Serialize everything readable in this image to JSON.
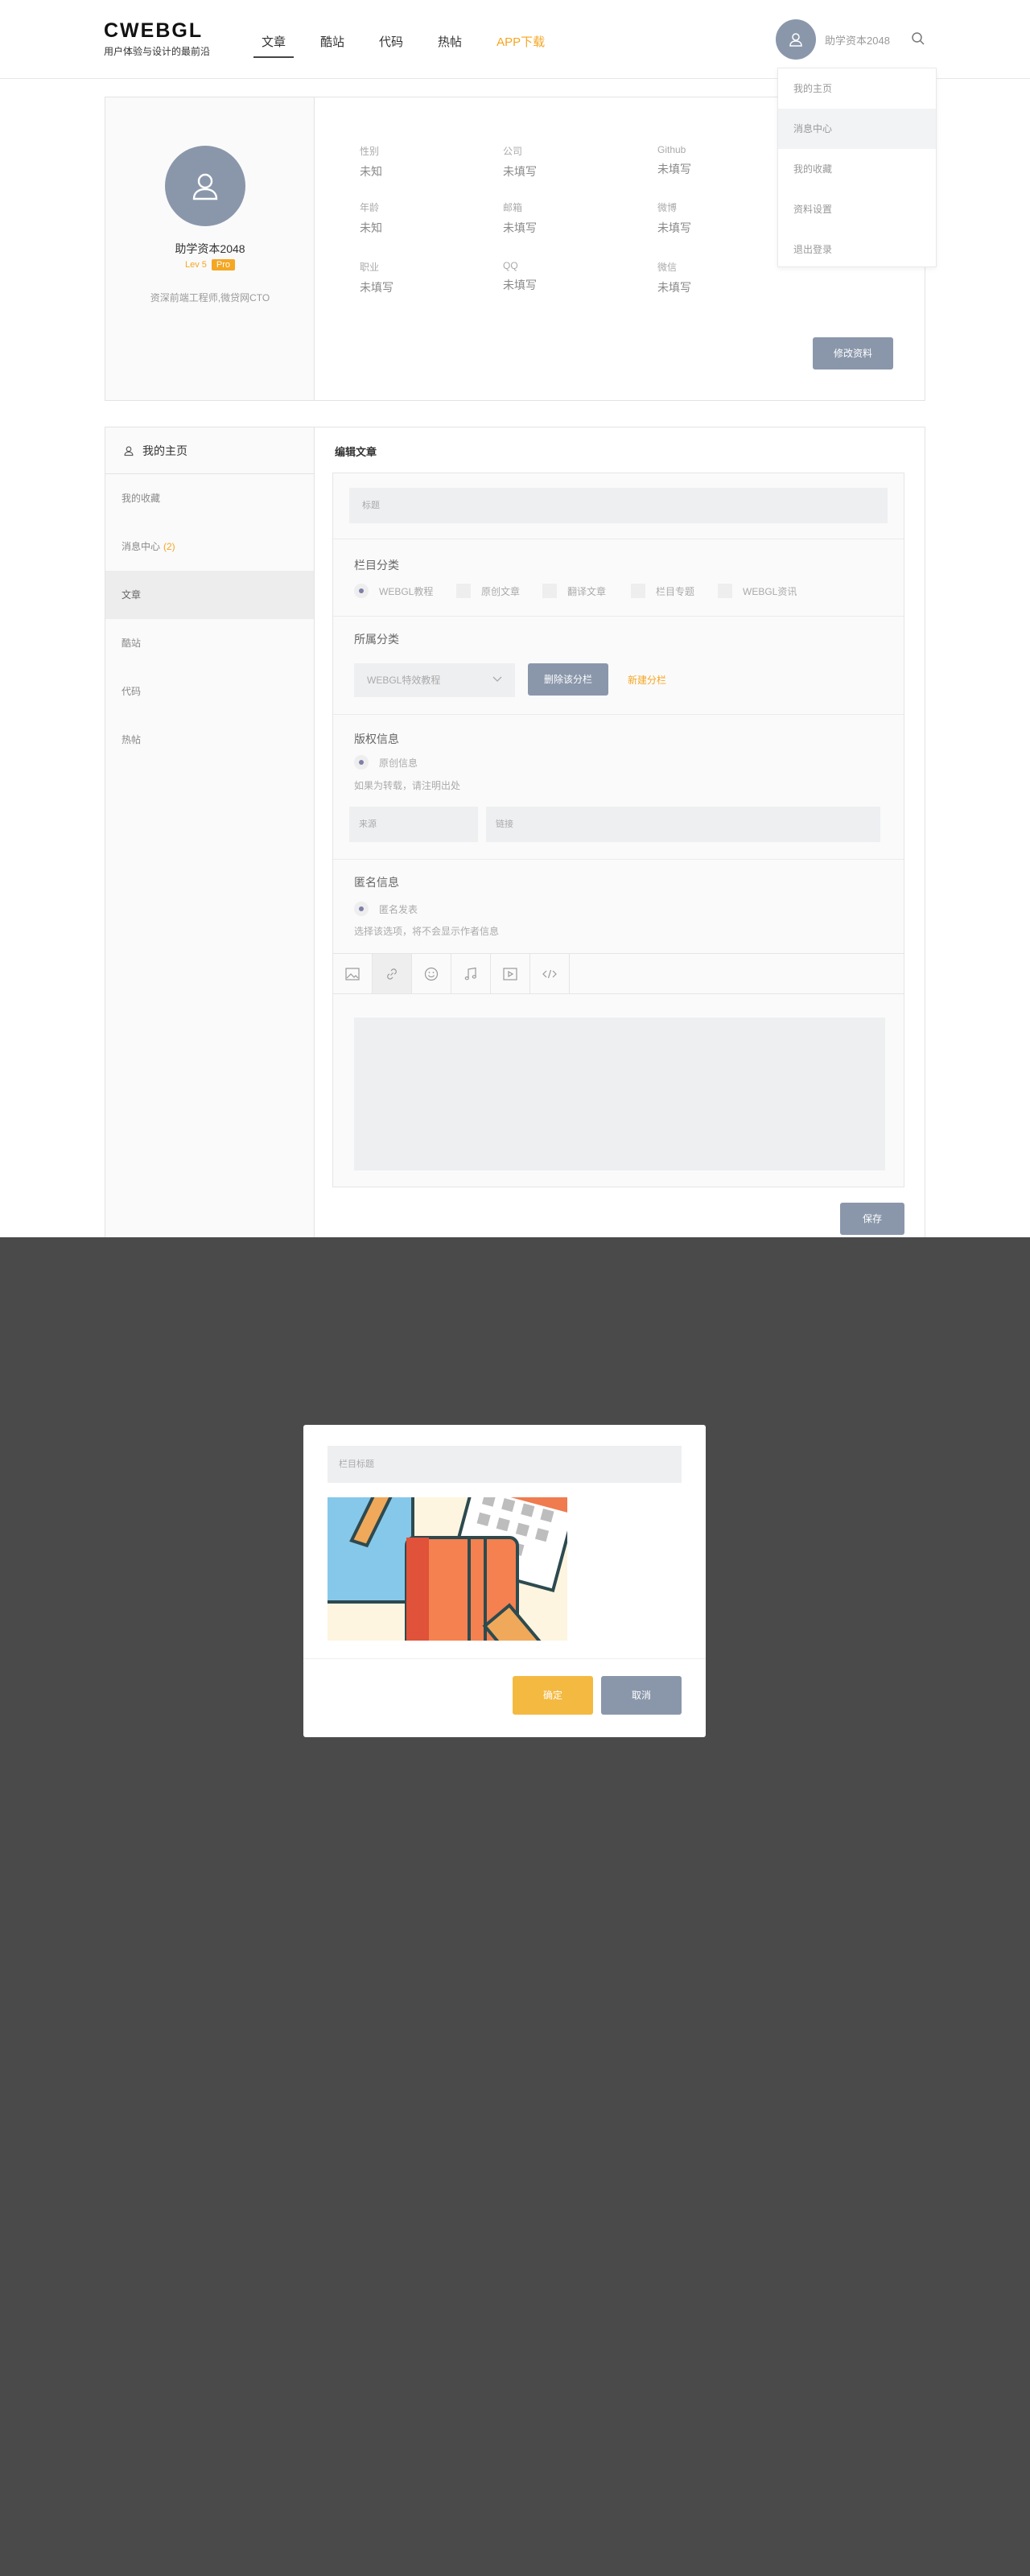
{
  "header": {
    "logo_title": "CWEBGL",
    "logo_subtitle": "用户体验与设计的最前沿",
    "nav": [
      "文章",
      "酷站",
      "代码",
      "热帖",
      "APP下载"
    ],
    "username": "助学资本2048"
  },
  "dropdown": [
    "我的主页",
    "消息中心",
    "我的收藏",
    "资料设置",
    "退出登录"
  ],
  "profile": {
    "name": "助学资本2048",
    "level": "Lev 5",
    "badge": "Pro",
    "desc": "资深前端工程师,微贷网CTO",
    "fields": [
      {
        "label": "性别",
        "value": "未知"
      },
      {
        "label": "公司",
        "value": "未填写"
      },
      {
        "label": "Github",
        "value": "未填写"
      },
      {
        "label": "年龄",
        "value": "未知"
      },
      {
        "label": "邮箱",
        "value": "未填写"
      },
      {
        "label": "微博",
        "value": "未填写"
      },
      {
        "label": "职业",
        "value": "未填写"
      },
      {
        "label": "QQ",
        "value": "未填写"
      },
      {
        "label": "微信",
        "value": "未填写"
      }
    ],
    "edit_button": "修改资料"
  },
  "sidebar": {
    "title": "我的主页",
    "items": [
      {
        "label": "我的收藏",
        "badge": ""
      },
      {
        "label": "消息中心",
        "badge": "(2)"
      },
      {
        "label": "文章",
        "badge": ""
      },
      {
        "label": "酷站",
        "badge": ""
      },
      {
        "label": "代码",
        "badge": ""
      },
      {
        "label": "热帖",
        "badge": ""
      }
    ]
  },
  "editor": {
    "heading": "编辑文章",
    "title_placeholder": "标题",
    "category_label": "栏目分类",
    "categories": [
      "WEBGL教程",
      "原创文章",
      "翻译文章",
      "栏目专题",
      "WEBGL资讯"
    ],
    "group_label": "所属分类",
    "group_select": "WEBGL特效教程",
    "delete_group_button": "删除该分栏",
    "new_group_link": "新建分栏",
    "copyright_label": "版权信息",
    "copyright_option": "原创信息",
    "copyright_hint": "如果为转载，请注明出处",
    "source_placeholder": "来源",
    "link_placeholder": "链接",
    "anon_label": "匿名信息",
    "anon_option": "匿名发表",
    "anon_hint": "选择该选项，将不会显示作者信息",
    "save_button": "保存"
  },
  "modal": {
    "title_placeholder": "栏目标题",
    "ok_button": "确定",
    "cancel_button": "取消"
  },
  "colors": {
    "accent": "#f5a623",
    "slate": "#8a97ab",
    "overlay": "#4a4a4a"
  }
}
